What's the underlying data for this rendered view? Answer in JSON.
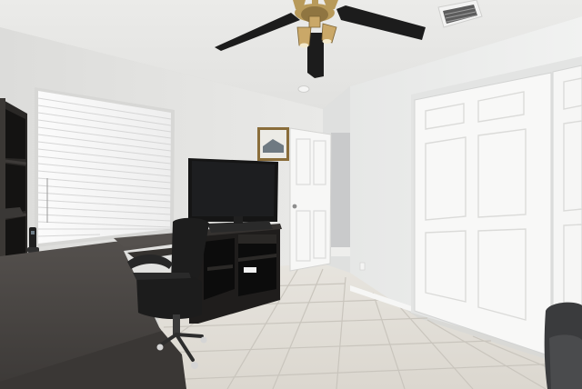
{
  "scene": {
    "colors": {
      "ceiling": "#e6e6e4",
      "wall_left": "#e4e4e2",
      "wall_right": "#ecedec",
      "floor_tile": "#e2dfd8",
      "grout": "#c8c4bc",
      "desk_top": "#4a4644",
      "cabinet": "#1f1d1c",
      "tv": "#151515",
      "door": "#f7f7f6",
      "blinds": "#f4f4f4",
      "fan_blade": "#1c1c1c",
      "fan_brass": "#b89a5a"
    },
    "objects": [
      "ceiling-fan",
      "air-vent",
      "window-blinds",
      "bookshelf",
      "desk",
      "cordless-phone",
      "office-chair",
      "tv-cabinet",
      "flat-screen-tv",
      "framed-picture",
      "bedroom-door",
      "closet-doors",
      "armchair",
      "tile-floor"
    ]
  }
}
